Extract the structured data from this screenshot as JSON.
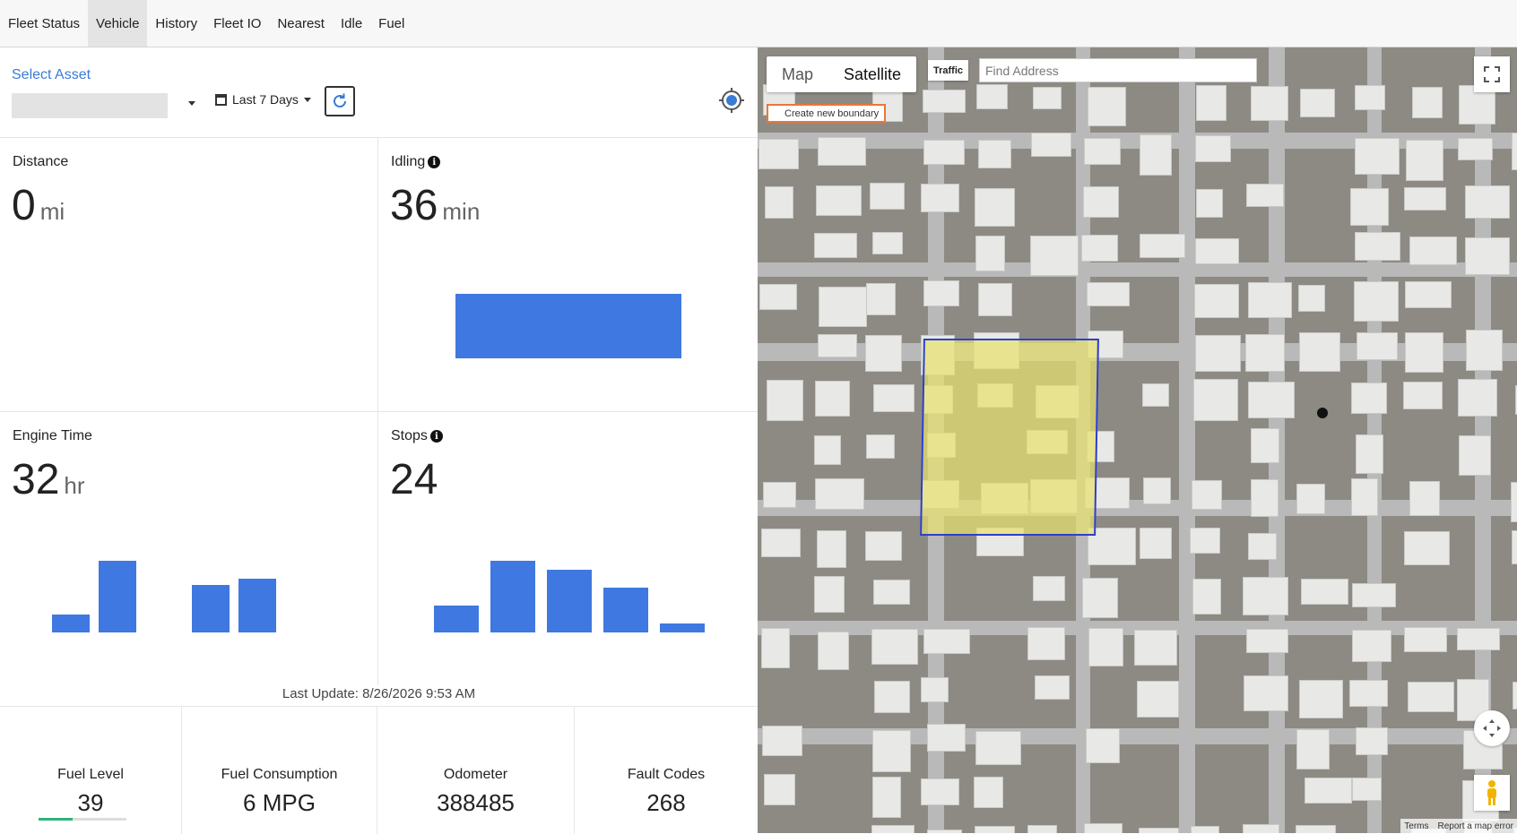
{
  "nav": {
    "tabs": [
      {
        "label": "Fleet Status"
      },
      {
        "label": "Vehicle"
      },
      {
        "label": "History"
      },
      {
        "label": "Fleet IO"
      },
      {
        "label": "Nearest"
      },
      {
        "label": "Idle"
      },
      {
        "label": "Fuel"
      }
    ],
    "active": "Vehicle"
  },
  "controls": {
    "select_asset_label": "Select Asset",
    "asset_value": "",
    "date_range": "Last 7 Days"
  },
  "metrics": {
    "distance": {
      "label": "Distance",
      "value": "0",
      "unit": "mi"
    },
    "idling": {
      "label": "Idling",
      "value": "36",
      "unit": "min",
      "chart_values": [
        36
      ]
    },
    "engine_time": {
      "label": "Engine Time",
      "value": "32",
      "unit": "hr",
      "chart_values": [
        2,
        8,
        0,
        5.3,
        6
      ]
    },
    "stops": {
      "label": "Stops",
      "value": "24",
      "unit": "",
      "chart_values": [
        3,
        8,
        7,
        5,
        1
      ]
    }
  },
  "last_update": "Last Update: 8/26/2026 9:53 AM",
  "footer": {
    "fuel_level": {
      "label": "Fuel Level",
      "value": "39",
      "fill_fraction": 0.39
    },
    "fuel_consumption": {
      "label": "Fuel Consumption",
      "value": "6 MPG"
    },
    "odometer": {
      "label": "Odometer",
      "value": "388485"
    },
    "fault_codes": {
      "label": "Fault Codes",
      "value": "268"
    }
  },
  "map": {
    "view_options": [
      "Map",
      "Satellite"
    ],
    "active_view": "Satellite",
    "traffic_label": "Traffic",
    "search_placeholder": "Find Address",
    "boundary_button": "Create new boundary",
    "attribution": {
      "terms": "Terms",
      "report": "Report a map error"
    },
    "colors": {
      "boundary_stroke": "#2b3fd1",
      "boundary_fill": "#e6e16e",
      "bar": "#3f78e0"
    }
  }
}
